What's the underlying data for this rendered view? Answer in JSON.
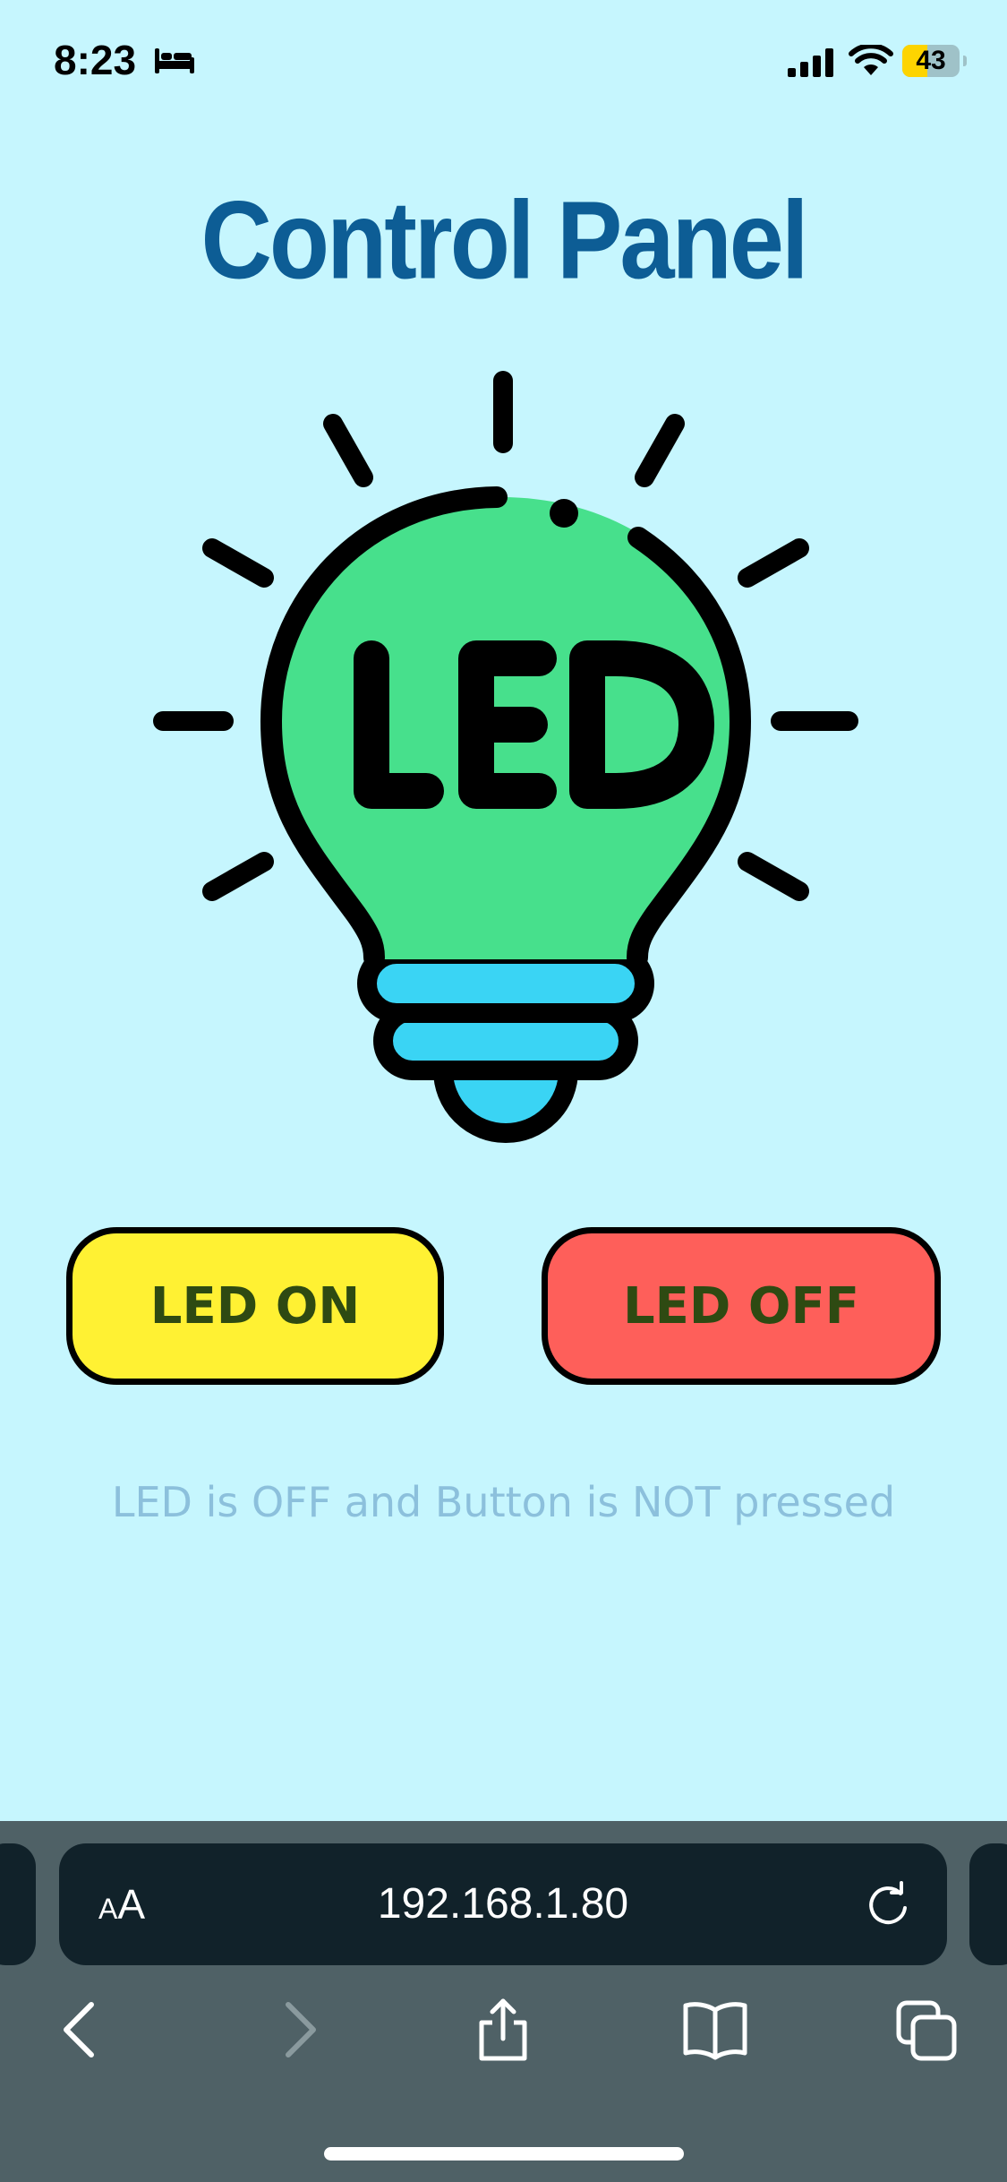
{
  "status_bar": {
    "time": "8:23",
    "battery_level": "43",
    "battery_fraction": 0.43,
    "icons": [
      "bed-icon",
      "signal-icon",
      "wifi-icon",
      "battery-icon"
    ]
  },
  "page": {
    "title": "Control Panel",
    "bulb_label": "LED",
    "buttons": {
      "on_label": "LED ON",
      "off_label": "LED OFF"
    },
    "status_message": "LED is OFF and Button is NOT pressed"
  },
  "browser": {
    "text_size_small": "A",
    "text_size_large": "A",
    "url": "192.168.1.80",
    "nav_icons": [
      "back-icon",
      "forward-icon",
      "share-icon",
      "bookmarks-icon",
      "tabs-icon",
      "reload-icon"
    ]
  },
  "colors": {
    "background": "#c6f6fe",
    "title": "#0d5d95",
    "bulb_glass": "#47e08c",
    "bulb_base": "#3ad4f4",
    "led_on_button": "#fff133",
    "led_off_button": "#fe5f5a",
    "button_text": "#2e4a12",
    "status_text": "#8cc0dc",
    "toolbar": "#4f6166",
    "url_bar": "#11222a"
  }
}
